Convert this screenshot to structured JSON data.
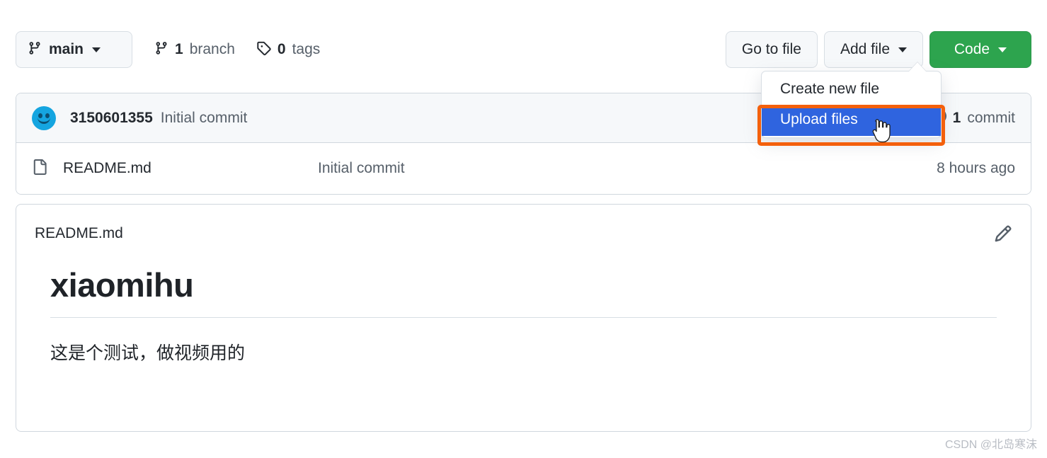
{
  "toolbar": {
    "branch_button": {
      "label": "main",
      "icon": "branch-icon",
      "caret": "chevron-down-icon"
    },
    "branch_count": {
      "num": "1",
      "word": "branch",
      "icon": "branch-icon"
    },
    "tag_count": {
      "num": "0",
      "word": "tags",
      "icon": "tag-icon"
    },
    "go_to_file": "Go to file",
    "add_file": "Add file",
    "code": "Code"
  },
  "dropdown": {
    "items": [
      {
        "label": "Create new file",
        "selected": false
      },
      {
        "label": "Upload files",
        "selected": true
      }
    ]
  },
  "commit_row": {
    "author": "3150601355",
    "message": "Initial commit",
    "count_num": "1",
    "count_word": "commit",
    "history_icon": "history-icon",
    "avatar": "avatar"
  },
  "file_row": {
    "icon": "file-icon",
    "name": "README.md",
    "commit_message": "Initial commit",
    "time": "8 hours ago"
  },
  "readme": {
    "title": "README.md",
    "edit_icon": "pencil-icon",
    "heading": "xiaomihu",
    "paragraph": "这是个测试，做视频用的"
  },
  "watermark": "CSDN @北岛寒沫",
  "colors": {
    "green_button": "#2da44e",
    "highlight_blue": "#2f64df",
    "annotation_orange": "#f4600c",
    "border_gray": "#d0d7de",
    "muted_text": "#57606a",
    "avatar_blue": "#15a5e0"
  }
}
